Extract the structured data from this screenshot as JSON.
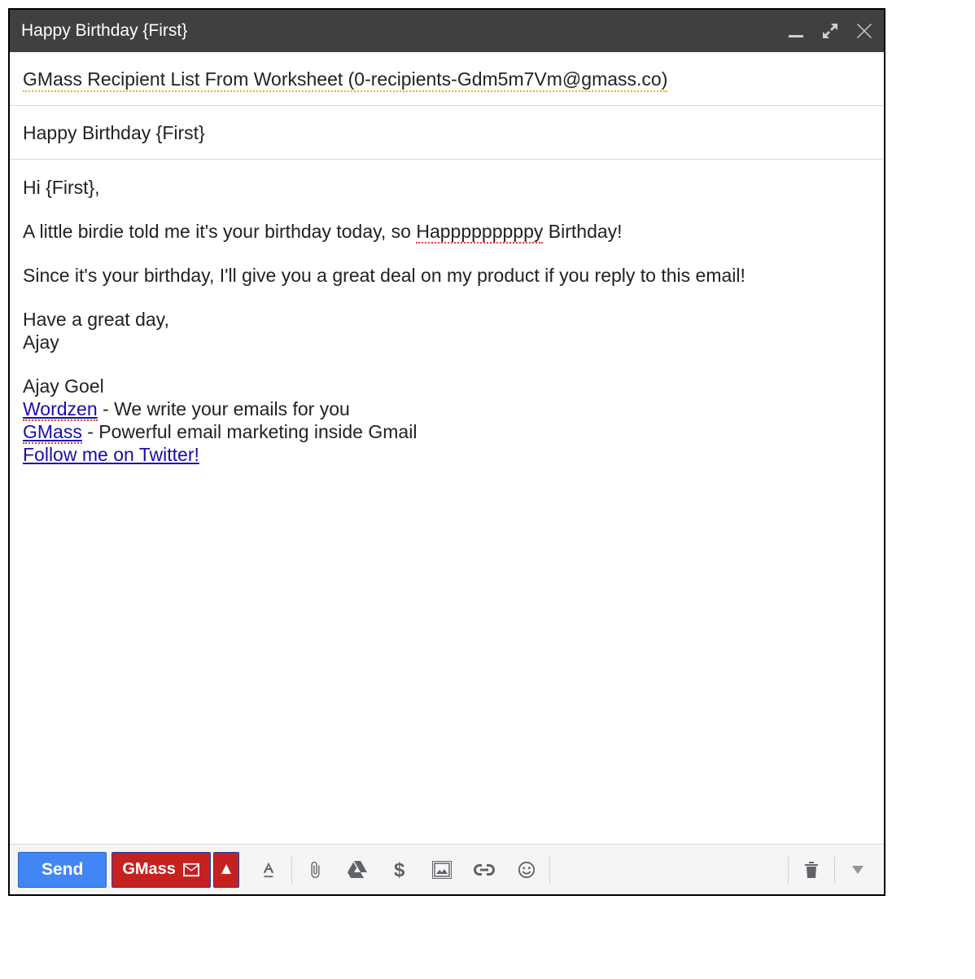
{
  "titlebar": {
    "title": "Happy Birthday {First}"
  },
  "to": "GMass Recipient List From Worksheet (0-recipients-Gdm5m7Vm@gmass.co)",
  "subject": "Happy Birthday {First}",
  "body": {
    "greeting": "Hi {First},",
    "p1_a": "A little birdie told me it's your birthday today, so ",
    "p1_spell": "Happpppppppy",
    "p1_b": " Birthday!",
    "p2": "Since it's your birthday, I'll give you a great deal on my product if you reply to this email!",
    "signoff1": "Have a great day,",
    "signoff2": "Ajay",
    "sig_name": "Ajay Goel",
    "sig_l1_link": "Wordzen",
    "sig_l1_text": " - We write your emails for you",
    "sig_l2_link": "GMass",
    "sig_l2_text": " - Powerful email marketing inside Gmail",
    "sig_l3_link": "Follow me on Twitter!"
  },
  "toolbar": {
    "send": "Send",
    "gmass": "GMass"
  }
}
